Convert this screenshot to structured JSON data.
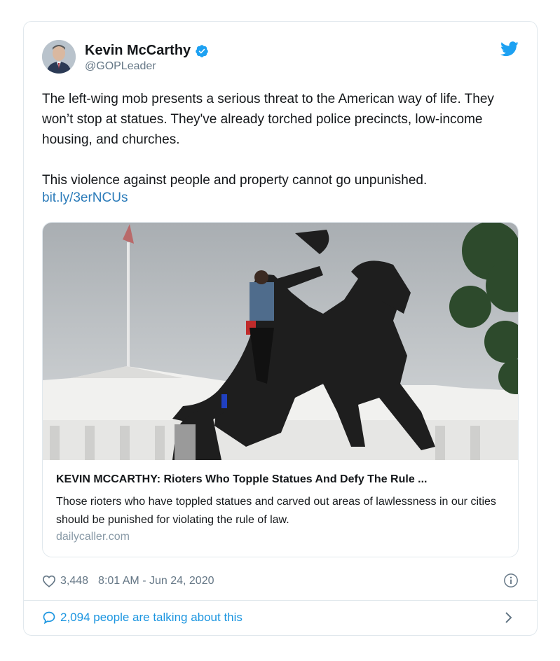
{
  "tweet": {
    "author_name": "Kevin McCarthy",
    "handle": "@GOPLeader",
    "text": "The left-wing mob presents a serious threat to the American way of life. They won’t stop at statues. They've already torched police precincts, low-income housing, and churches.\n\nThis violence against people and property cannot go unpunished.",
    "link": "bit.ly/3erNCUs",
    "likes": "3,448",
    "timestamp": "8:01 AM - Jun 24, 2020",
    "conversation": "2,094 people are talking about this"
  },
  "preview": {
    "title": "KEVIN MCCARTHY: Rioters Who Topple Statues And Defy The Rule ...",
    "description": "Those rioters who have toppled statues and carved out areas of lawlessness in our cities should be punished for violating the rule of law.",
    "domain": "dailycaller.com"
  },
  "icons": {
    "verified": "verified-badge-icon",
    "bird": "twitter-bird-icon",
    "heart": "heart-icon",
    "info": "info-icon",
    "bubble": "speech-bubble-icon",
    "chevron": "chevron-right-icon"
  },
  "colors": {
    "accent": "#1da1f2",
    "link": "#2b7bb9",
    "muted": "#657786",
    "border": "#e1e8ed"
  }
}
